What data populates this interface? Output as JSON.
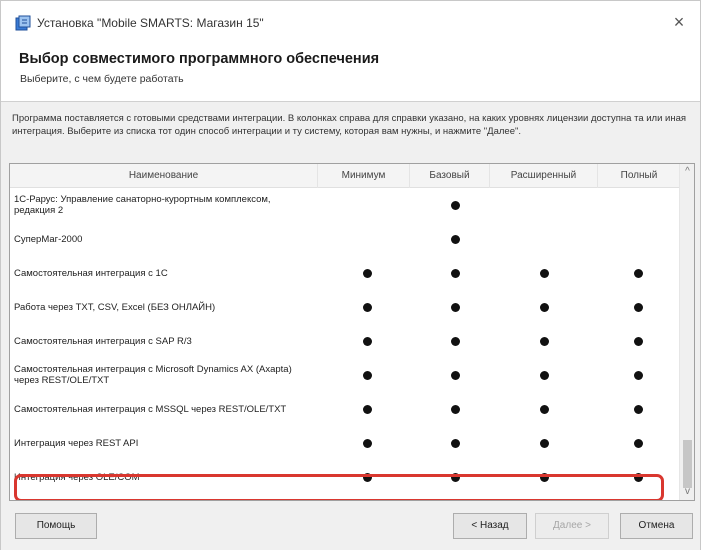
{
  "window": {
    "title": "Установка \"Mobile SMARTS: Магазин 15\"",
    "close_glyph": "×"
  },
  "header": {
    "title": "Выбор совместимого программного обеспечения",
    "subtitle": "Выберите, с чем будете работать"
  },
  "description": "Программа поставляется с готовыми средствами интеграции. В колонках справа для справки указано, на каких уровнях лицензии доступна та или иная интеграция. Выберите из списка тот один способ интеграции и ту систему, которая вам нужны, и нажмите \"Далее\".",
  "table": {
    "columns": {
      "name": "Наименование",
      "min": "Минимум",
      "base": "Базовый",
      "ext": "Расширенный",
      "full": "Полный"
    },
    "rows": [
      {
        "name": "1С-Рарус: Управление санаторно-курортным комплексом, редакция 2",
        "min": false,
        "base": true,
        "ext": false,
        "full": false
      },
      {
        "name": "СуперМаг-2000",
        "min": false,
        "base": true,
        "ext": false,
        "full": false
      },
      {
        "name": "Самостоятельная интеграция с 1С",
        "min": true,
        "base": true,
        "ext": true,
        "full": true
      },
      {
        "name": "Работа через TXT, CSV, Excel (БЕЗ ОНЛАЙН)",
        "min": true,
        "base": true,
        "ext": true,
        "full": true
      },
      {
        "name": "Самостоятельная интеграция с SAP R/3",
        "min": true,
        "base": true,
        "ext": true,
        "full": true
      },
      {
        "name": "Самостоятельная интеграция с Microsoft Dynamics AX (Axapta) через REST/OLE/TXT",
        "min": true,
        "base": true,
        "ext": true,
        "full": true
      },
      {
        "name": "Самостоятельная интеграция с MSSQL через REST/OLE/TXT",
        "min": true,
        "base": true,
        "ext": true,
        "full": true
      },
      {
        "name": "Интеграция через REST API",
        "min": true,
        "base": true,
        "ext": true,
        "full": true
      },
      {
        "name": "Интеграция через OLE/COM",
        "min": true,
        "base": true,
        "ext": true,
        "full": true
      }
    ],
    "highlighted_row": "Интеграция через REST API",
    "highlight_color": "#d9372f"
  },
  "scrollbar": {
    "up_glyph": "^",
    "down_glyph": "v"
  },
  "footer": {
    "help_label": "Помощь",
    "back_label": "< Назад",
    "next_label": "Далее >",
    "cancel_label": "Отмена"
  }
}
